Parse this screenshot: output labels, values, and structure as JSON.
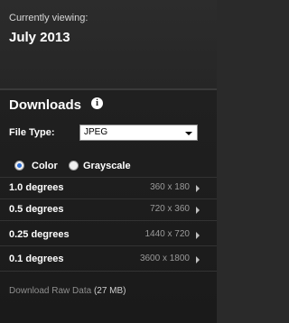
{
  "header": {
    "label": "Currently viewing:",
    "title": "July 2013"
  },
  "downloads": {
    "title": "Downloads",
    "info_icon": "info-icon",
    "file_type_label": "File Type:",
    "file_type_value": "JPEG",
    "color_options": [
      {
        "label": "Color",
        "checked": true
      },
      {
        "label": "Grayscale",
        "checked": false
      }
    ],
    "resolutions": [
      {
        "label": "1.0 degrees",
        "size": "360 x 180"
      },
      {
        "label": "0.5 degrees",
        "size": "720 x 360"
      },
      {
        "label": "0.25 degrees",
        "size": "1440 x 720"
      },
      {
        "label": "0.1 degrees",
        "size": "3600 x 1800"
      }
    ],
    "raw_link": {
      "text": "Download Raw Data",
      "size": "(27 MB)"
    }
  }
}
